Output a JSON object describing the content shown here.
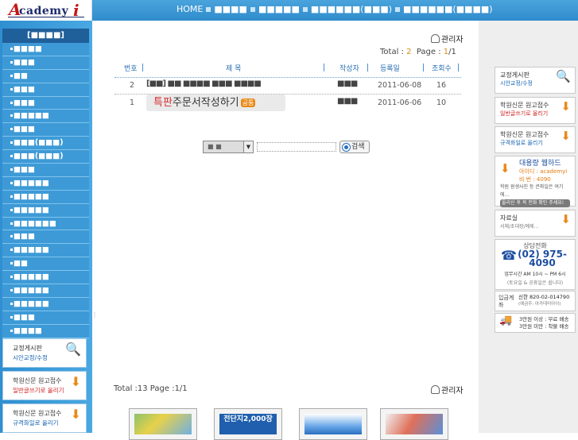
{
  "header": {
    "logo": {
      "first": "A",
      "rest": "cademy",
      "last": "i"
    },
    "nav": [
      "HOME",
      "■■■■",
      "■■■■■",
      "■■■■■■(■■■)",
      "■■■■■■(■■■■)"
    ]
  },
  "sidebar": {
    "title": "[■■■■]",
    "items": [
      "■■■■",
      "■■■",
      "■■",
      "■■■",
      "■■■",
      "■■■■■",
      "■■■",
      "■■■(■■■)",
      "■■■(■■■)",
      "■■■",
      "■■■■■",
      "■■■■■",
      "■■■■■",
      "■■■■■■",
      "■■■",
      "■■■■■",
      "■■",
      "■■■■■",
      "■■■■■",
      "■■■■■",
      "■■■",
      "■■■■"
    ],
    "banners": [
      {
        "title": "교정게시판",
        "sub": "시안교정/수정",
        "sub_color": "blue"
      },
      {
        "title": "학원신문 원고접수",
        "sub": "일반글쓰기로 올리기",
        "sub_color": "red"
      },
      {
        "title": "학원신문 원고접수",
        "sub": "규격화일로 올리기",
        "sub_color": "blue"
      }
    ]
  },
  "board": {
    "admin_label": "관리자",
    "total_label": "Total : ",
    "total_value": "2",
    "page_label": "Page : ",
    "page_current": "1",
    "page_total": "/1",
    "columns": [
      "번호",
      "제 목",
      "작성자",
      "등록일",
      "조회수"
    ],
    "rows": [
      {
        "no": "2",
        "title": "[■■] ■■ ■■■■ ■■■ ■■■■",
        "author": "■■■",
        "date": "2011-06-08",
        "views": "16"
      },
      {
        "no": "1",
        "title_red": "특판",
        "title": "주문서작성하기",
        "tag": "공통",
        "author": "■■■",
        "date": "2011-06-06",
        "views": "10"
      }
    ],
    "search": {
      "select_value": "■ ■",
      "button": "검색"
    }
  },
  "gallery": {
    "admin_label": "관리자",
    "total_text": "Total :13  Page :1/1",
    "thumbs": [
      "",
      "전단지2,000장",
      "",
      ""
    ]
  },
  "right_banners": {
    "b1": {
      "title": "교정게시판",
      "sub": "시안교정/수정"
    },
    "b2": {
      "title": "학원신문 원고접수",
      "sub": "일반글쓰기로 올리기"
    },
    "b3": {
      "title": "학원신문 원고접수",
      "sub": "규격화일로 올리기"
    },
    "b4": {
      "title": "대용량 웹하드",
      "id": "아이디 : academyi",
      "pw": "비  번 : 4090",
      "line1": "학원 원생사진 등 큰파일은 여기에...",
      "line2": "올리신 후 꼭 전화 확인 주세요!"
    },
    "b5": {
      "title": "자료실",
      "sub": "서체/초대장/예제..."
    },
    "b6": {
      "title": "상담전화",
      "number": "(02) 975-4090",
      "hours": "업무시간  AM 10시 ~ PM 6시",
      "note": "(토요일 & 공휴일은 쉽니다)"
    },
    "b7": {
      "label": "입금계좌",
      "bank": "신한 820-02-014790",
      "holder": "(예금주: 아카데미아이)"
    },
    "b8": {
      "line1": "3만원 이상 : 무료 배송",
      "line2": "3만원 미만 : 착불 배송"
    }
  }
}
